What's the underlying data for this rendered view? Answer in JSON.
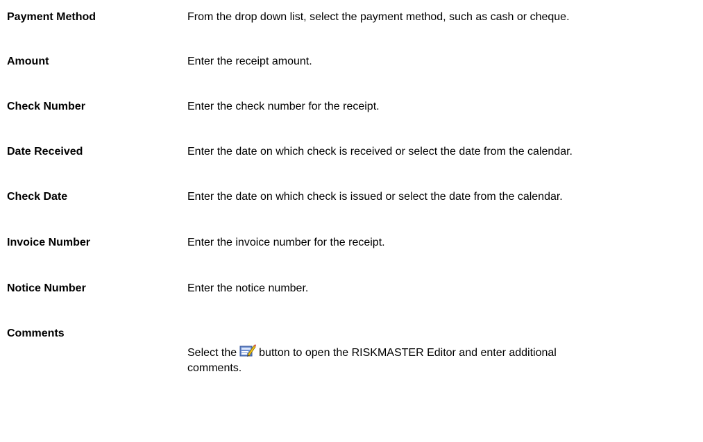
{
  "fields": [
    {
      "label": "Payment Method",
      "description": "From the drop down list, select the payment method, such as cash or cheque."
    },
    {
      "label": "Amount",
      "description": "Enter the receipt amount."
    },
    {
      "label": "Check Number",
      "description": "Enter the check number for the receipt."
    },
    {
      "label": "Date Received",
      "description": "Enter the date on which check is received or select the date from the calendar."
    },
    {
      "label": "Check Date",
      "description": "Enter the date on which check is issued or select the date from the calendar."
    },
    {
      "label": "Invoice Number",
      "description": "Enter the invoice number for the receipt."
    },
    {
      "label": "Notice Number",
      "description": "Enter the notice number."
    }
  ],
  "comments": {
    "label": "Comments",
    "text_before": "Select the",
    "icon": "editor-icon",
    "text_after": "button to open the RISKMASTER Editor and enter additional comments."
  }
}
